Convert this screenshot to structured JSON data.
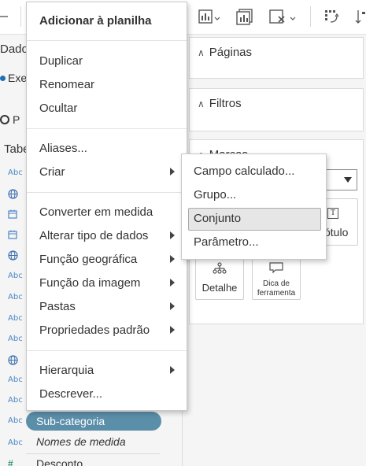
{
  "left_pane": {
    "data_label": "Dado",
    "datasource_label": "Exe",
    "search_text": "P",
    "tables_label": "Tabe",
    "field_icons": [
      "Abc",
      "globe",
      "calendar",
      "calendar",
      "globe",
      "Abc",
      "Abc",
      "Abc",
      "Abc",
      "globe",
      "Abc",
      "Abc",
      "Abc",
      "Abc",
      "Abc"
    ],
    "selected_field": "Sub-categoria",
    "measure_names": "Nomes de medida",
    "last_field": "Desconto",
    "hash_symbol": "#"
  },
  "shelves": {
    "pages_title": "Páginas",
    "filters_title": "Filtros",
    "marks_title": "Marcas",
    "detail_label": "Detalhe",
    "tooltip_label_line1": "Dica de",
    "tooltip_label_line2": "ferramenta",
    "label_partial": "ótulo"
  },
  "context_menu": {
    "header": "Adicionar à planilha",
    "group1": [
      "Duplicar",
      "Renomear",
      "Ocultar"
    ],
    "aliases": "Aliases...",
    "create": "Criar",
    "group3": [
      {
        "label": "Converter em medida",
        "submenu": false
      },
      {
        "label": "Alterar tipo de dados",
        "submenu": true
      },
      {
        "label": "Função geográfica",
        "submenu": true
      },
      {
        "label": "Função da imagem",
        "submenu": true
      },
      {
        "label": "Pastas",
        "submenu": true
      },
      {
        "label": "Propriedades padrão",
        "submenu": true
      }
    ],
    "hierarchy": "Hierarquia",
    "describe": "Descrever..."
  },
  "create_submenu": {
    "items": [
      "Campo calculado...",
      "Grupo...",
      "Conjunto",
      "Parâmetro..."
    ],
    "highlighted": "Conjunto"
  },
  "colors": {
    "selected_pill": "#5b8ea9",
    "field_icon_blue": "#4b87c4",
    "measure_green": "#2f9a6a"
  }
}
